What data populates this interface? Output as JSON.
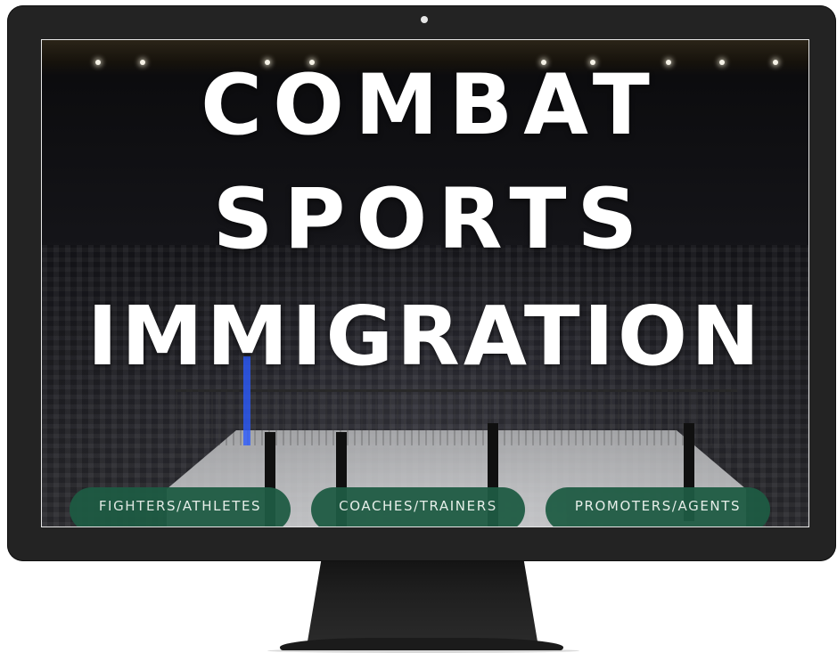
{
  "hero": {
    "headline_line1": "COMBAT",
    "headline_line2": "SPORTS",
    "headline_line3": "IMMIGRATION"
  },
  "buttons": [
    {
      "label": "FIGHTERS/ATHLETES"
    },
    {
      "label": "COACHES/TRAINERS"
    },
    {
      "label": "PROMOTERS/AGENTS"
    }
  ],
  "colors": {
    "monitor_bezel": "#232323",
    "button_bg": "#1e5b43",
    "headline_text": "#ffffff"
  }
}
